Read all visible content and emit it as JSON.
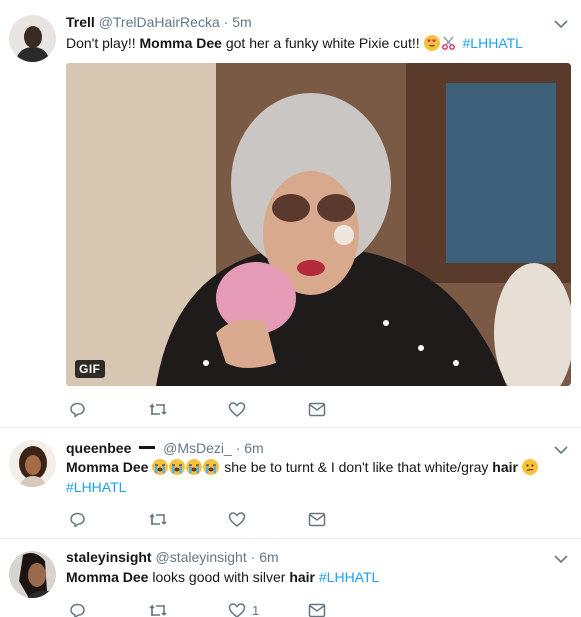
{
  "tweets": [
    {
      "name": "Trell",
      "handle": "@TrelDaHairRecka",
      "dot": "·",
      "time": "5m",
      "text_pre": "Don't play!! ",
      "text_bold": "Momma Dee",
      "text_post": " got her a funky white Pixie cut!! ",
      "emoji": [
        "heart-eyes",
        "scissors"
      ],
      "hashtag": "#LHHATL",
      "media_badge": "GIF"
    },
    {
      "name": "queenbee",
      "handle": "@MsDezi_",
      "dot": "·",
      "time": "6m",
      "text_bold": "Momma Dee",
      "emoji": [
        "loudly-crying",
        "loudly-crying",
        "loudly-crying",
        "loudly-crying"
      ],
      "text_mid": " she be to turnt & I don't like that white/gray ",
      "text_bold2": "hair",
      "emoji2": [
        "confused"
      ],
      "hashtag": "#LHHATL"
    },
    {
      "name": "staleyinsight",
      "handle": "@staleyinsight",
      "dot": "·",
      "time": "6m",
      "text_bold": "Momma Dee",
      "text_mid": " looks good with silver ",
      "text_bold2": "hair",
      "hashtag": " #LHHATL",
      "like_count": "1"
    }
  ],
  "icons": [
    "reply-icon",
    "retweet-icon",
    "like-icon",
    "message-icon",
    "chevron-down-icon"
  ],
  "colors": {
    "accent": "#1da1f2",
    "muted": "#657786",
    "divider": "#e6ecf0",
    "emoji": "#f5c33b"
  }
}
